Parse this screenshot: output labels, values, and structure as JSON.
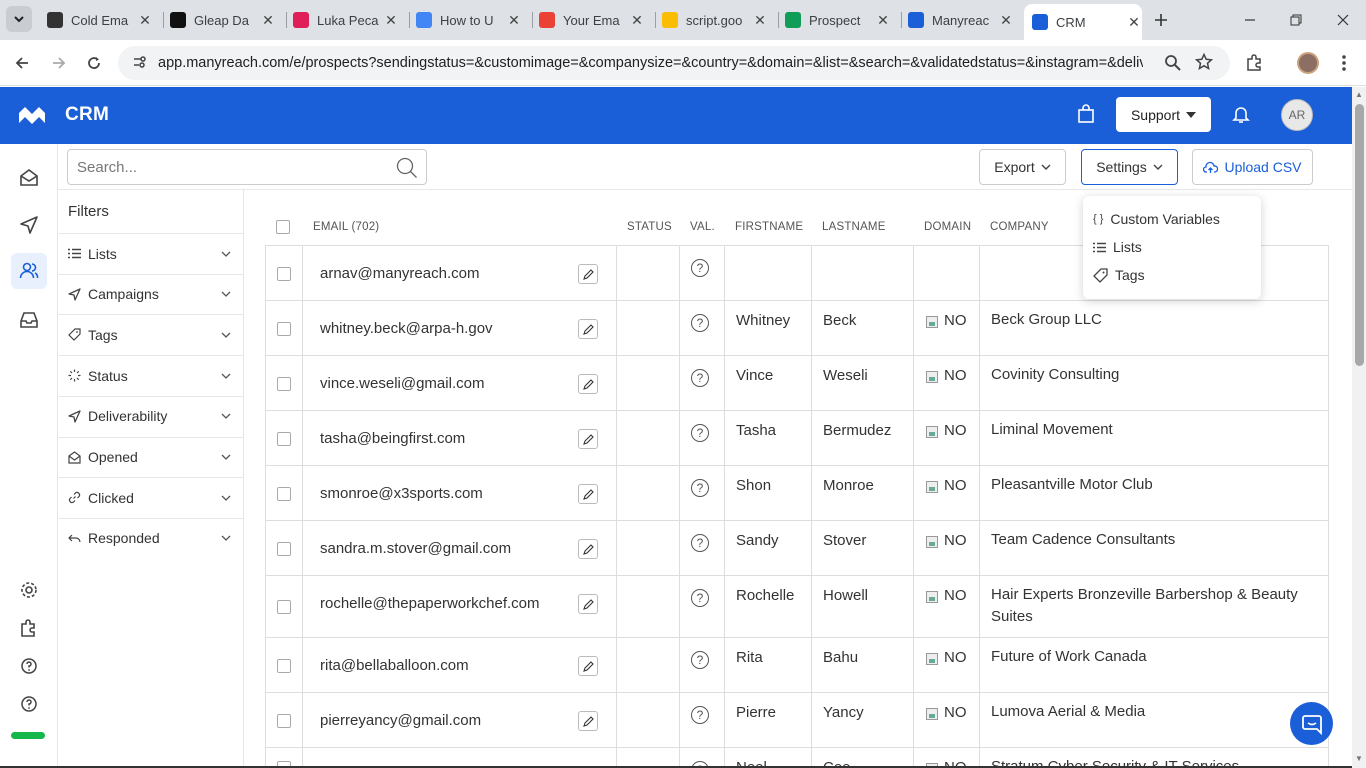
{
  "browser": {
    "tabs": [
      {
        "title": "Cold Ema",
        "favicon": "openai-icon",
        "color": "#333333"
      },
      {
        "title": "Gleap Da",
        "favicon": "gleap-icon",
        "color": "#111111"
      },
      {
        "title": "Luka Peca",
        "favicon": "slack-icon",
        "color": "#e01e5a"
      },
      {
        "title": "How to U",
        "favicon": "docs-icon",
        "color": "#4285f4"
      },
      {
        "title": "Your Ema",
        "favicon": "gmail-icon",
        "color": "#ea4335"
      },
      {
        "title": "script.goo",
        "favicon": "apps-script-icon",
        "color": "#fbbc04"
      },
      {
        "title": "Prospect",
        "favicon": "sheets-icon",
        "color": "#0f9d58"
      },
      {
        "title": "Manyreac",
        "favicon": "manyreach-icon",
        "color": "#1a5fd8"
      },
      {
        "title": "CRM",
        "favicon": "manyreach-icon",
        "color": "#1a5fd8"
      }
    ],
    "url": "app.manyreach.com/e/prospects?sendingstatus=&customimage=&companysize=&country=&domain=&list=&search=&validatedstatus=&instagram=&deliv..."
  },
  "app": {
    "title": "CRM",
    "support_label": "Support",
    "user_initials": "AR"
  },
  "search": {
    "placeholder": "Search..."
  },
  "actions": {
    "export_label": "Export",
    "settings_label": "Settings",
    "upload_label": "Upload CSV"
  },
  "settings_menu": [
    {
      "label": "Custom Variables",
      "icon": "braces-icon"
    },
    {
      "label": "Lists",
      "icon": "list-icon"
    },
    {
      "label": "Tags",
      "icon": "tag-icon"
    }
  ],
  "filters": {
    "title": "Filters",
    "items": [
      {
        "label": "Lists",
        "icon": "list-icon"
      },
      {
        "label": "Campaigns",
        "icon": "send-icon"
      },
      {
        "label": "Tags",
        "icon": "tag-icon"
      },
      {
        "label": "Status",
        "icon": "loader-icon"
      },
      {
        "label": "Deliverability",
        "icon": "send-icon"
      },
      {
        "label": "Opened",
        "icon": "mail-open-icon"
      },
      {
        "label": "Clicked",
        "icon": "link-icon"
      },
      {
        "label": "Responded",
        "icon": "reply-icon"
      }
    ]
  },
  "table": {
    "columns": {
      "email": "EMAIL (702)",
      "status": "STATUS",
      "val": "VAL.",
      "firstname": "FIRSTNAME",
      "lastname": "LASTNAME",
      "domain": "DOMAIN",
      "company": "COMPANY"
    },
    "rows": [
      {
        "email": "arnav@manyreach.com",
        "first": "",
        "last": "",
        "domain": "",
        "company": ""
      },
      {
        "email": "whitney.beck@arpa-h.gov",
        "first": "Whitney",
        "last": "Beck",
        "domain": "NO",
        "company": "Beck Group LLC"
      },
      {
        "email": "vince.weseli@gmail.com",
        "first": "Vince",
        "last": "Weseli",
        "domain": "NO",
        "company": "Covinity Consulting"
      },
      {
        "email": "tasha@beingfirst.com",
        "first": "Tasha",
        "last": "Bermudez",
        "domain": "NO",
        "company": "Liminal Movement"
      },
      {
        "email": "smonroe@x3sports.com",
        "first": "Shon",
        "last": "Monroe",
        "domain": "NO",
        "company": "Pleasantville Motor Club"
      },
      {
        "email": "sandra.m.stover@gmail.com",
        "first": "Sandy",
        "last": "Stover",
        "domain": "NO",
        "company": "Team Cadence Consultants"
      },
      {
        "email": "rochelle@thepaperworkchef.com",
        "first": "Rochelle",
        "last": "Howell",
        "domain": "NO",
        "company": "Hair Experts Bronzeville Barbershop & Beauty Suites"
      },
      {
        "email": "rita@bellaballoon.com",
        "first": "Rita",
        "last": "Bahu",
        "domain": "NO",
        "company": "Future of Work Canada"
      },
      {
        "email": "pierreyancy@gmail.com",
        "first": "Pierre",
        "last": "Yancy",
        "domain": "NO",
        "company": "Lumova Aerial & Media"
      },
      {
        "email": "",
        "first": "Neel",
        "last": "Cee",
        "domain": "NO",
        "company": "Stratum Cyber Security & IT Services"
      }
    ]
  }
}
